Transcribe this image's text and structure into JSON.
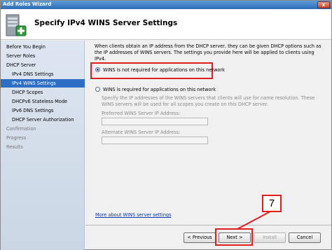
{
  "window": {
    "title": "Add Roles Wizard",
    "close_glyph": "x"
  },
  "header": {
    "heading": "Specify IPv4 WINS Server Settings",
    "icon": "server-wizard-icon"
  },
  "nav": {
    "items": [
      {
        "label": "Before You Begin",
        "state": "normal"
      },
      {
        "label": "Server Roles",
        "state": "normal"
      },
      {
        "label": "DHCP Server",
        "state": "normal"
      },
      {
        "label": "IPv4 DNS Settings",
        "state": "normal"
      },
      {
        "label": "IPv4 WINS Settings",
        "state": "selected"
      },
      {
        "label": "DHCP Scopes",
        "state": "normal"
      },
      {
        "label": "DHCPv6 Stateless Mode",
        "state": "normal"
      },
      {
        "label": "IPv6 DNS Settings",
        "state": "normal"
      },
      {
        "label": "DHCP Server Authorization",
        "state": "normal"
      },
      {
        "label": "Confirmation",
        "state": "disabled"
      },
      {
        "label": "Progress",
        "state": "disabled"
      },
      {
        "label": "Results",
        "state": "disabled"
      }
    ]
  },
  "content": {
    "intro": "When clients obtain an IP address from the DHCP server, they can be given DHCP options such as the IP addresses of WINS servers. The settings you provide here will be applied to clients using IPv4.",
    "option_not_required": "WINS is not required for applications on this network",
    "option_required": "WINS is required for applications on this network",
    "selected_option": "not_required",
    "required_desc": "Specify the IP addresses of the WINS servers that clients will use for name resolution. These WINS servers will be used for all scopes you create on this DHCP server.",
    "preferred_label": "Preferred WINS Server IP Address:",
    "preferred_value": "",
    "alternate_label": "Alternate WINS Server IP Address:",
    "alternate_value": "",
    "more_link": "More about WINS server settings"
  },
  "buttons": {
    "previous": "< Previous",
    "next": "Next >",
    "install": "Install",
    "cancel": "Cancel"
  },
  "annotation": {
    "step_number": "7",
    "highlight_color": "#e01e1e"
  },
  "colors": {
    "selected_nav": "#2f6ec5",
    "link": "#0a38b0"
  }
}
